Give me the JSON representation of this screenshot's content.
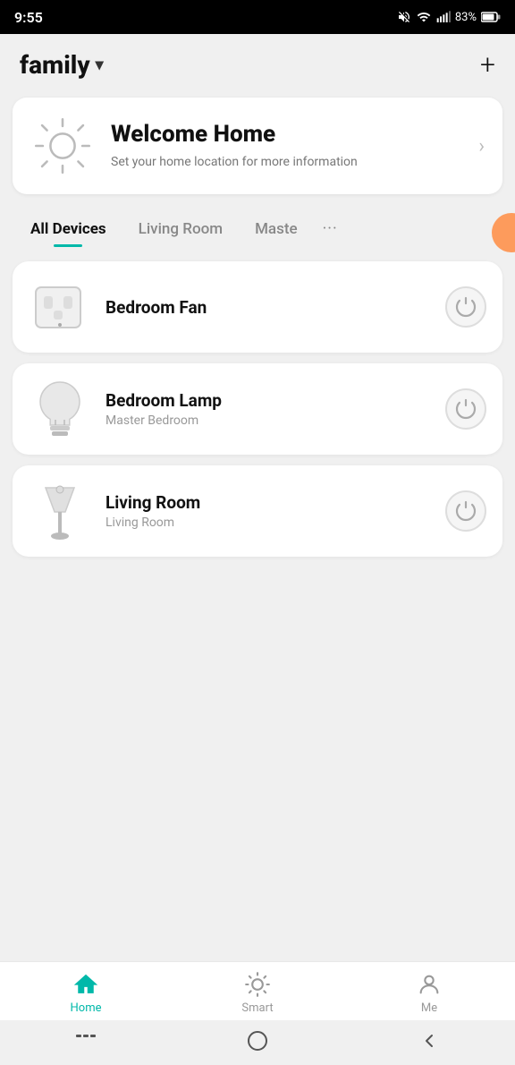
{
  "statusBar": {
    "time": "9:55",
    "battery": "83%"
  },
  "header": {
    "family": "family",
    "addIcon": "+"
  },
  "welcome": {
    "title": "Welcome Home",
    "subtitle": "Set your home location for more information",
    "chevron": "›"
  },
  "tabs": [
    {
      "label": "All Devices",
      "active": true
    },
    {
      "label": "Living Room",
      "active": false
    },
    {
      "label": "Maste",
      "active": false
    }
  ],
  "devices": [
    {
      "name": "Bedroom Fan",
      "location": "",
      "type": "outlet"
    },
    {
      "name": "Bedroom Lamp",
      "location": "Master Bedroom",
      "type": "bulb"
    },
    {
      "name": "Living Room",
      "location": "Living Room",
      "type": "lamp"
    }
  ],
  "bottomNav": [
    {
      "label": "Home",
      "icon": "home",
      "active": true
    },
    {
      "label": "Smart",
      "icon": "smart",
      "active": false
    },
    {
      "label": "Me",
      "icon": "me",
      "active": false
    }
  ],
  "colors": {
    "accent": "#00b8a9",
    "orange": "#ff8c42"
  }
}
